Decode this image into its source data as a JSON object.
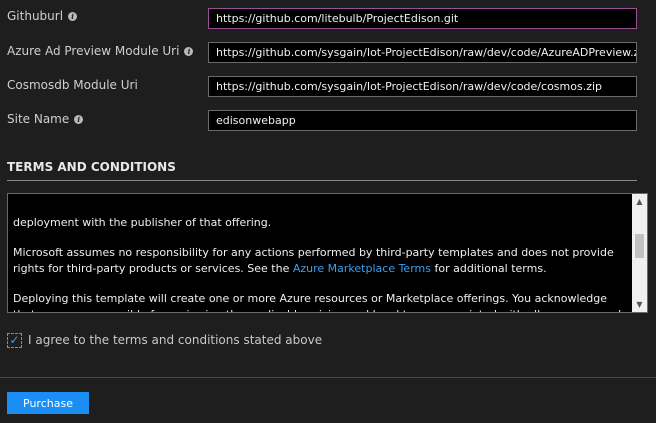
{
  "fields": [
    {
      "label": "Githuburl",
      "has_info": true,
      "value": "https://github.com/litebulb/ProjectEdison.git",
      "focused": true
    },
    {
      "label": "Azure Ad Preview Module Uri",
      "has_info": true,
      "value": "https://github.com/sysgain/Iot-ProjectEdison/raw/dev/code/AzureADPreview.zip",
      "focused": false
    },
    {
      "label": "Cosmosdb Module Uri",
      "has_info": false,
      "value": "https://github.com/sysgain/Iot-ProjectEdison/raw/dev/code/cosmos.zip",
      "focused": false
    },
    {
      "label": "Site Name",
      "has_info": true,
      "value": "edisonwebapp",
      "focused": false
    }
  ],
  "info_icon_glyph": "i",
  "terms": {
    "title": "TERMS AND CONDITIONS",
    "paragraph1": "deployment with the publisher of that offering.",
    "paragraph2_before_link": "Microsoft assumes no responsibility for any actions performed by third-party templates and does not provide rights for third-party products or services. See the ",
    "paragraph2_link": "Azure Marketplace Terms",
    "paragraph2_after_link": " for additional terms.",
    "paragraph3": "Deploying this template will create one or more Azure resources or Marketplace offerings.  You acknowledge that you are responsible for reviewing the applicable pricing and legal terms associated with all resources and offerings"
  },
  "agree": {
    "label": "I agree to the terms and conditions stated above",
    "checked": true,
    "check_glyph": "✓"
  },
  "purchase_label": "Purchase",
  "colors": {
    "background": "#1e1e1e",
    "accent": "#1a8ef2",
    "link": "#3aa0f0",
    "focus_border": "#9b4f96"
  }
}
